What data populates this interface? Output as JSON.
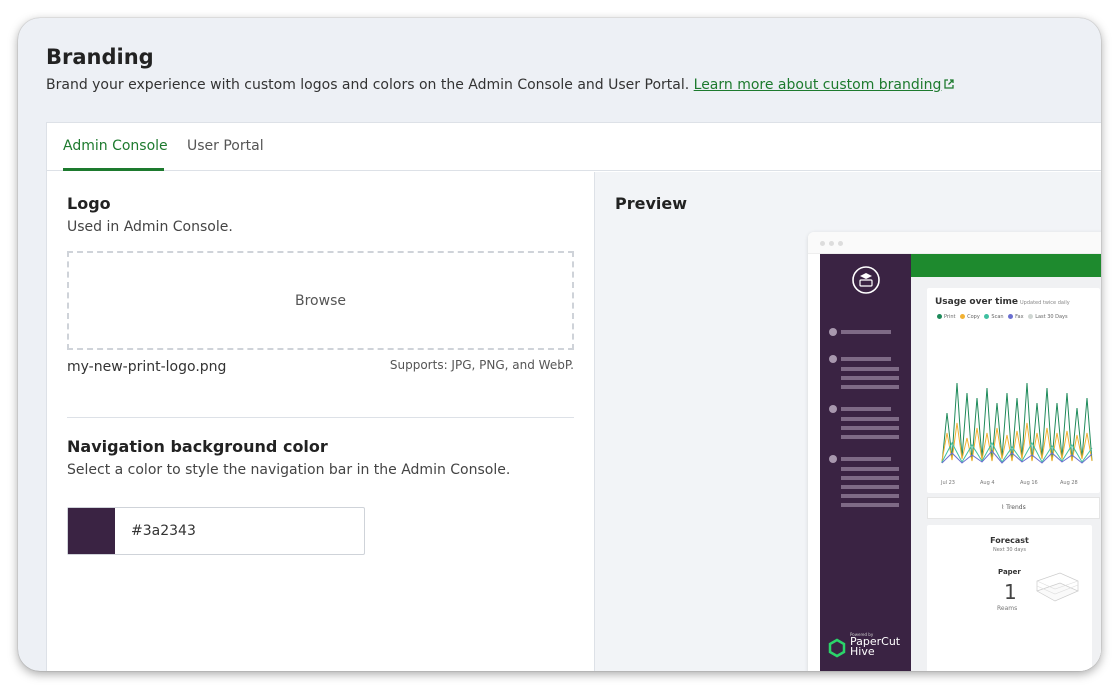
{
  "header": {
    "title": "Branding",
    "description": "Brand your experience with custom logos and colors on the Admin Console and User Portal.",
    "learn_more_link": "Learn more about custom branding"
  },
  "tabs": [
    {
      "label": "Admin Console",
      "active": true
    },
    {
      "label": "User Portal",
      "active": false
    }
  ],
  "logo": {
    "title": "Logo",
    "subtitle": "Used in Admin Console.",
    "browse_label": "Browse",
    "filename": "my-new-print-logo.png",
    "supports": "Supports: JPG, PNG, and WebP."
  },
  "nav_color": {
    "title": "Navigation background color",
    "subtitle": "Select a color to style the navigation bar in the Admin Console.",
    "value": "#3a2343"
  },
  "preview": {
    "title": "Preview",
    "chart_title": "Usage over time",
    "chart_note": "Updated twice daily",
    "legend": [
      "Print",
      "Copy",
      "Scan",
      "Fax",
      "Last 30 Days"
    ],
    "legend_colors": [
      "#1e8a5a",
      "#f2b233",
      "#3fbfa0",
      "#6a6fd0",
      "#cfd6d2"
    ],
    "x_labels": [
      "Jul 23",
      "Aug 4",
      "Aug 16",
      "Aug 28"
    ],
    "trends_label": "Trends",
    "forecast_title": "Forecast",
    "forecast_sub": "Next 30 days",
    "forecast_item": "Paper",
    "forecast_value": "1",
    "forecast_unit": "Reams",
    "powered_by": "Powered by",
    "brand_name_1": "PaperCut",
    "brand_name_2": "Hive"
  },
  "colors": {
    "accent": "#1d7a2e",
    "nav_bg": "#3a2343",
    "preview_header": "#1e8a2e"
  }
}
